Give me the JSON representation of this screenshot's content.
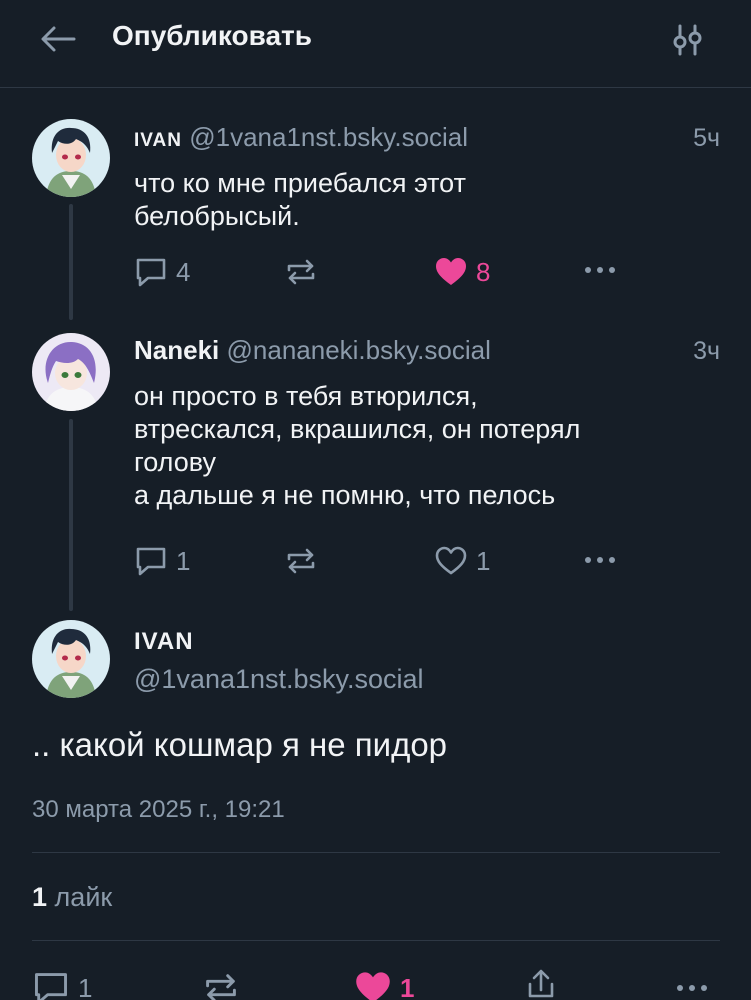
{
  "header": {
    "title": "Опубликовать",
    "back_icon": "arrow-left-icon",
    "settings_icon": "sliders-icon"
  },
  "thread": [
    {
      "name": "IVAN",
      "handle": "@1vana1nst.bsky.social",
      "time": "5ч",
      "text_lines": [
        "что ко мне приебался этот",
        "белобрысый."
      ],
      "replies": "4",
      "reposts": "",
      "likes": "8",
      "liked": true
    },
    {
      "name": "Naneki",
      "handle": "@nananeki.bsky.social",
      "time": "3ч",
      "text_lines": [
        "он просто в тебя втюрился,",
        "втрескался, вкрашился, он потерял",
        "голову",
        "а дальше я не помню, что пелось"
      ],
      "replies": "1",
      "reposts": "",
      "likes": "1",
      "liked": false
    }
  ],
  "main_post": {
    "name": "IVAN",
    "handle": "@1vana1nst.bsky.social",
    "text": ".. какой кошмар я не пидор",
    "date": "30 марта 2025 г., 19:21",
    "like_count": "1",
    "like_label": "лайк",
    "actions": {
      "replies": "1",
      "likes": "1"
    }
  },
  "colors": {
    "background": "#161e27",
    "muted": "#8c9bab",
    "like_accent": "#ec4899",
    "divider": "#2e3844"
  }
}
